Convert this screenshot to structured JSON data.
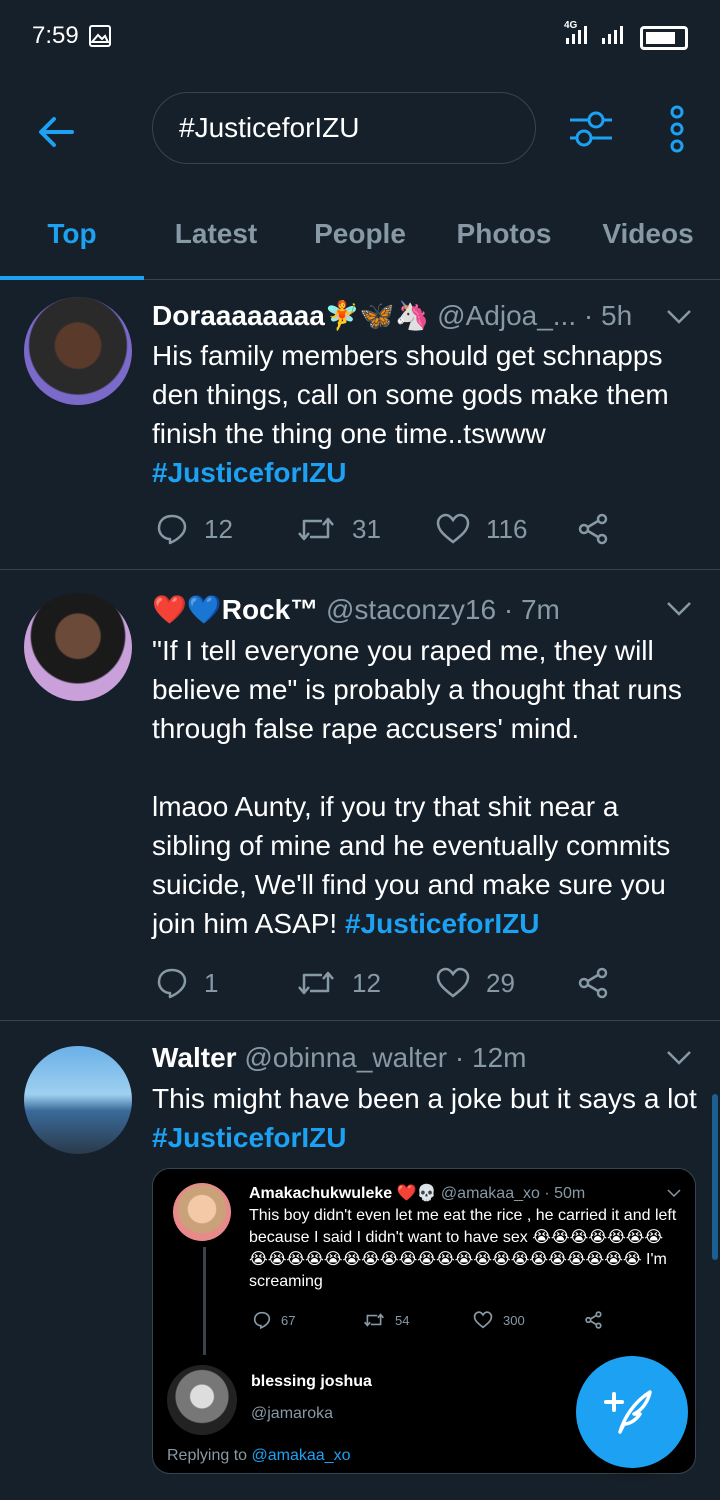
{
  "status": {
    "time": "7:59",
    "network": "4G"
  },
  "search": {
    "query": "#JusticeforIZU"
  },
  "tabs": [
    "Top",
    "Latest",
    "People",
    "Photos",
    "Videos"
  ],
  "tweets": [
    {
      "name": "Doraaaaaaaa🧚🦋🦄",
      "handle": "@Adjoa_...",
      "time": "· 5h",
      "text": "His family members should get schnapps den things, call on some gods make them finish the thing one time..tswww ",
      "hashtag": "#JusticeforIZU",
      "replies": "12",
      "retweets": "31",
      "likes": "116"
    },
    {
      "name": "❤️💙Rock™",
      "handle": "@staconzy16",
      "time": "· 7m",
      "text": "\"If I tell everyone you raped me, they will believe me\" is probably a thought that runs through false rape accusers' mind.\n\nlmaoo Aunty, if you try that shit near a sibling of mine and he eventually commits suicide, We'll find you and make sure you join him ASAP! ",
      "hashtag": "#JusticeforIZU",
      "replies": "1",
      "retweets": "12",
      "likes": "29"
    },
    {
      "name": "Walter",
      "handle": "@obinna_walter",
      "time": "· 12m",
      "text": "This might have been a joke but it says a lot ",
      "hashtag": "#JusticeforIZU"
    }
  ],
  "embed": {
    "first": {
      "name": "Amakachukwuleke ❤️💀",
      "handle": "@amakaa_xo",
      "time": "· 50m",
      "text": "This boy didn't even let me eat the rice , he carried it and left because I said I didn't want to have sex 😭😭😭😭😭😭😭😭😭😭😭😭😭😭😭😭😭😭😭😭😭😭😭😭😭😭😭😭 I'm screaming",
      "replies": "67",
      "retweets": "54",
      "likes": "300"
    },
    "second": {
      "name": "blessing joshua",
      "handle": "@jamaroka",
      "replying_label": "Replying to ",
      "replying_to": "@amakaa_xo"
    }
  },
  "colors": {
    "accent": "#1da1f2",
    "background": "#15202b",
    "muted": "#8899a6",
    "divider": "#38444d"
  }
}
